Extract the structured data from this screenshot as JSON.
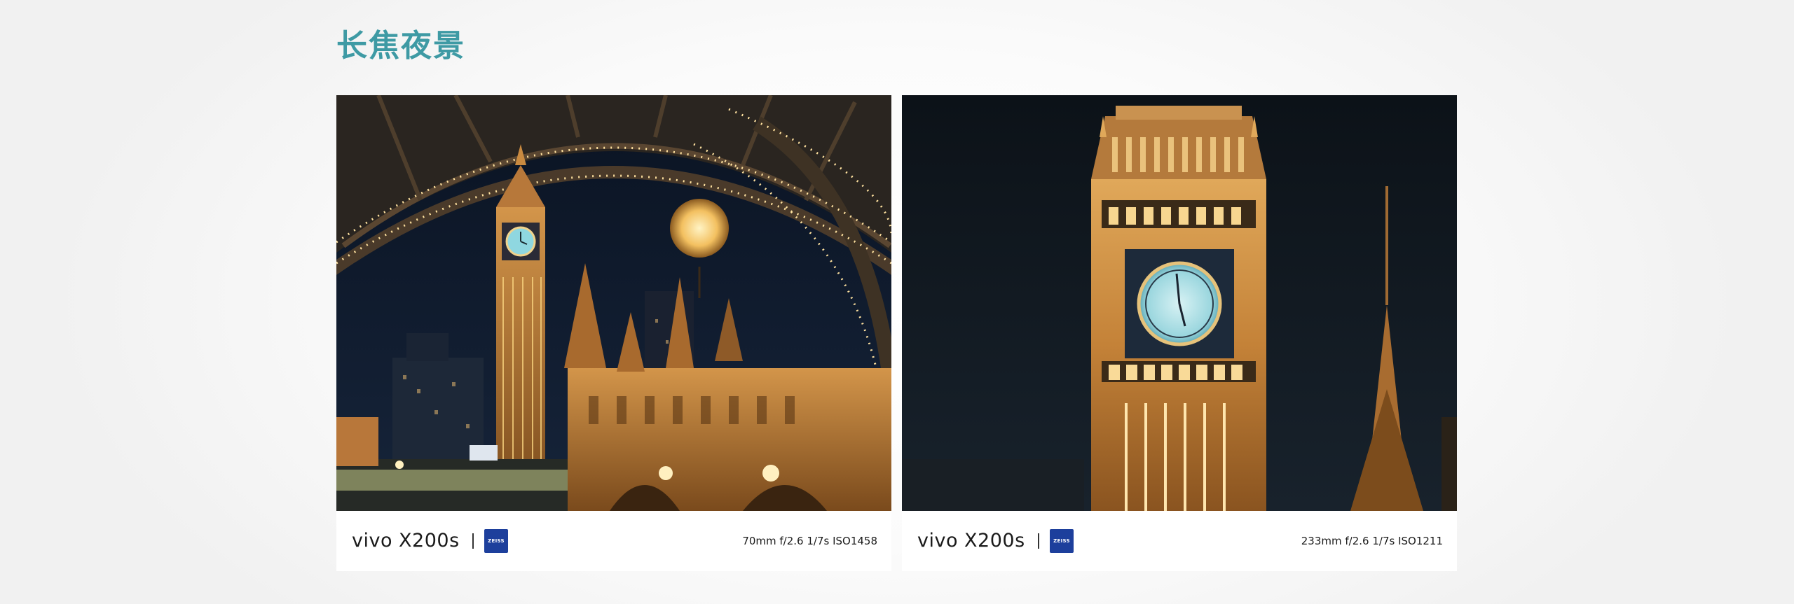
{
  "section": {
    "heading": "长焦夜景"
  },
  "cards": [
    {
      "brand": "vivo X200s",
      "zeiss_logo": "ZEISS",
      "exif": "70mm  f/2.6  1/7s  ISO1458",
      "photo_icon": "big-ben-under-arch-photo"
    },
    {
      "brand": "vivo X200s",
      "zeiss_logo": "ZEISS",
      "exif": "233mm  f/2.6  1/7s  ISO1211",
      "photo_icon": "big-ben-clock-face-photo"
    }
  ],
  "colors": {
    "heading": "#3e9aa4",
    "zeiss_blue": "#1d3f9c",
    "night_sky": "#0e1624",
    "stone_lit": "#c8873e"
  }
}
